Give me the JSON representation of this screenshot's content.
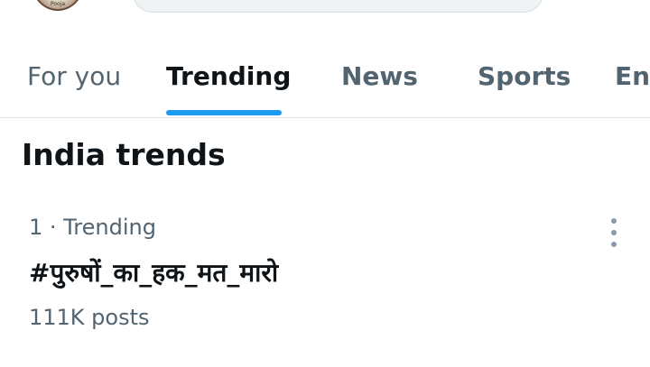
{
  "header": {
    "avatar_caption": "Pooja"
  },
  "tabs": [
    {
      "label": "For you"
    },
    {
      "label": "Trending"
    },
    {
      "label": "News"
    },
    {
      "label": "Sports"
    },
    {
      "label": "Ent"
    }
  ],
  "active_tab": "Trending",
  "section": {
    "title": "India trends"
  },
  "trends": [
    {
      "meta": "1 · Trending",
      "name": "#पुरुषों_का_हक_मत_मारो",
      "posts": "111K posts"
    }
  ],
  "colors": {
    "accent": "#1d9bf0",
    "muted_text": "#536471",
    "primary_text": "#0f1419"
  },
  "icons": {
    "trend_menu": "more-vertical-icon"
  }
}
